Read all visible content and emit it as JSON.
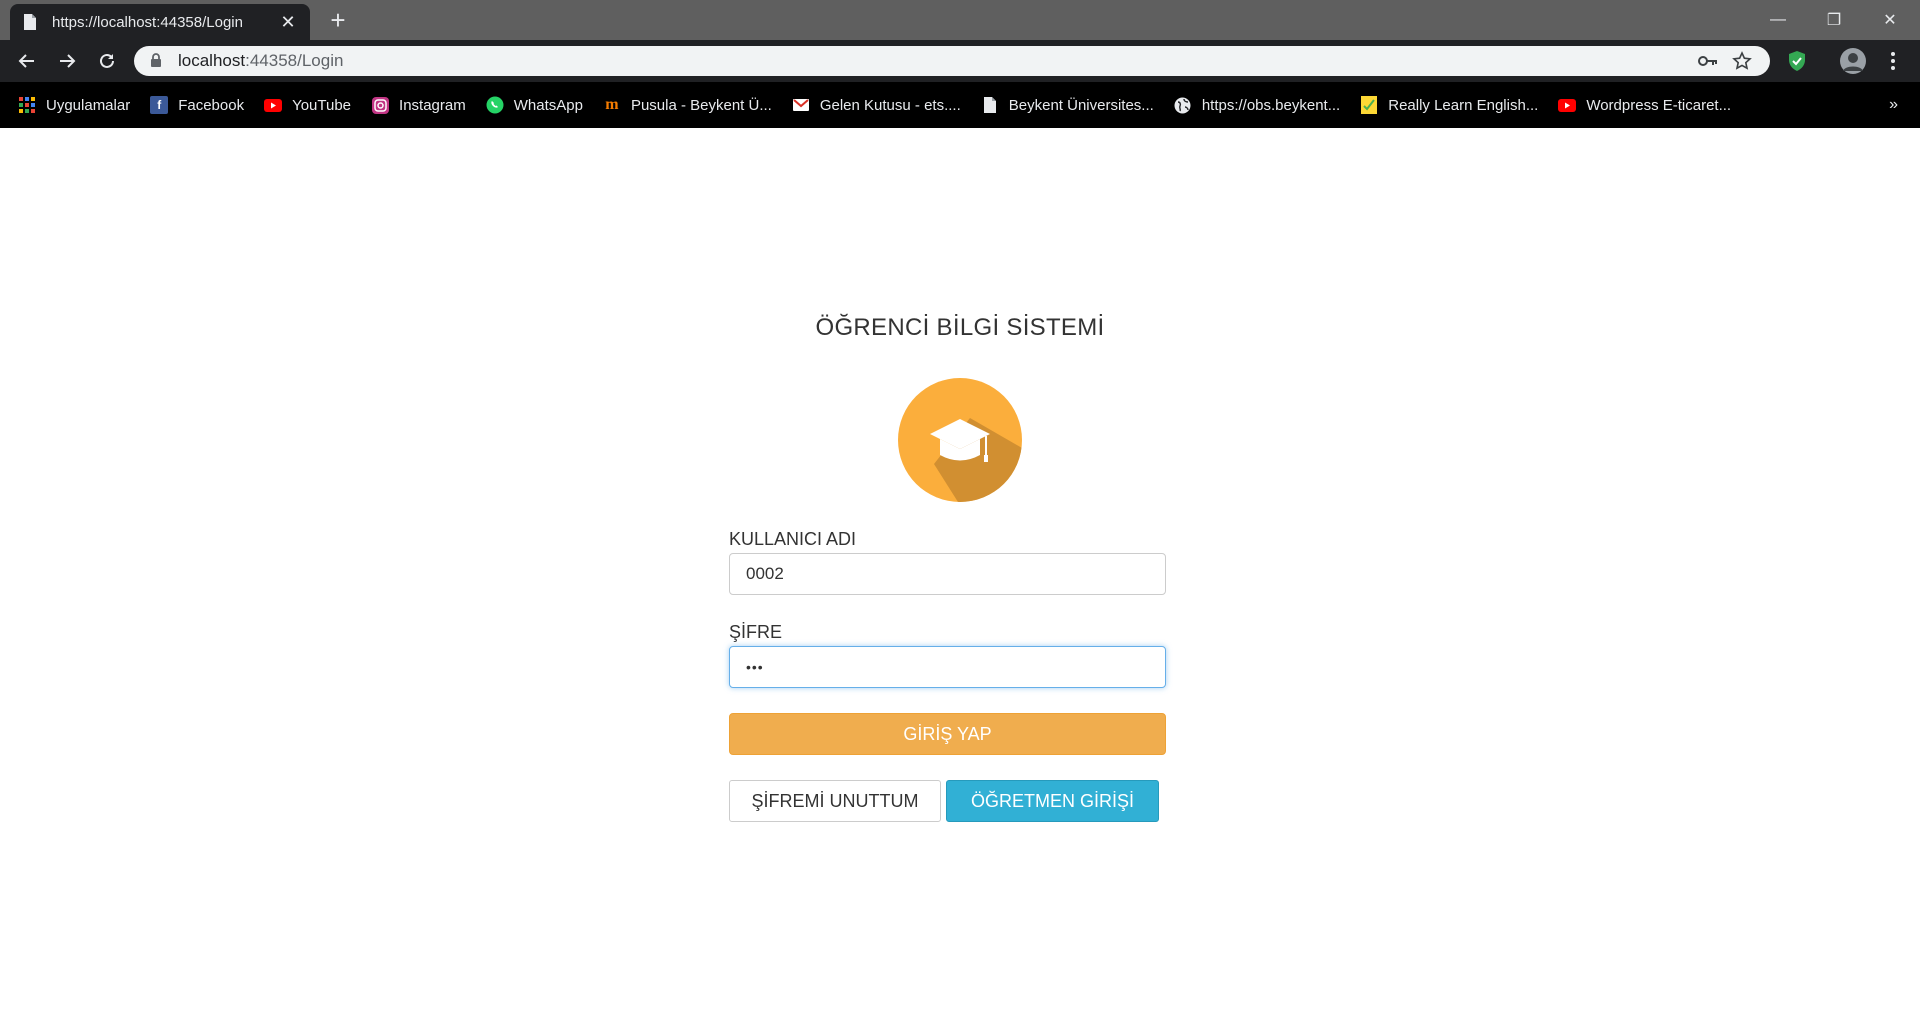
{
  "browser": {
    "tab": {
      "title": "https://localhost:44358/Login",
      "close": "✕"
    },
    "new_tab": "+",
    "window": {
      "minimize": "—",
      "restore": "❐",
      "close": "✕"
    },
    "address": {
      "host": "localhost",
      "path": ":44358/Login"
    },
    "bookmarks": [
      {
        "label": "Uygulamalar",
        "icon": "apps-grid-icon"
      },
      {
        "label": "Facebook",
        "icon": "facebook-icon",
        "color": "#3b5998"
      },
      {
        "label": "YouTube",
        "icon": "youtube-icon",
        "color": "#ff0000"
      },
      {
        "label": "Instagram",
        "icon": "instagram-icon",
        "color": "#c13584"
      },
      {
        "label": "WhatsApp",
        "icon": "whatsapp-icon",
        "color": "#25d366"
      },
      {
        "label": "Pusula - Beykent Ü...",
        "icon": "pusula-icon",
        "color": "#f57c00"
      },
      {
        "label": "Gelen Kutusu  - ets....",
        "icon": "gmail-icon",
        "color": "#d93025"
      },
      {
        "label": "Beykent Üniversites...",
        "icon": "page-icon"
      },
      {
        "label": "https://obs.beykent...",
        "icon": "globe-icon"
      },
      {
        "label": "Really Learn English...",
        "icon": "note-icon",
        "color": "#fdd835"
      },
      {
        "label": "Wordpress E-ticaret...",
        "icon": "youtube-icon",
        "color": "#ff0000"
      }
    ],
    "bookmarks_more": "»"
  },
  "login": {
    "title": "ÖĞRENCİ BİLGİ SİSTEMİ",
    "username_label": "KULLANICI ADI",
    "username_value": "0002",
    "password_label": "ŞİFRE",
    "password_value": "•••",
    "submit_label": "GİRİŞ YAP",
    "forgot_label": "ŞİFREMİ UNUTTUM",
    "teacher_label": "ÖĞRETMEN GİRİŞİ"
  },
  "colors": {
    "logo_circle": "#fbae3c",
    "submit": "#f0ad4e",
    "teacher": "#31b0d5"
  }
}
